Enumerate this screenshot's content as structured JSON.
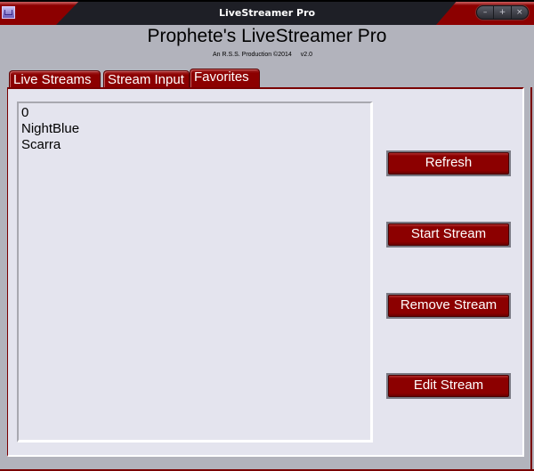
{
  "window": {
    "title": "LiveStreamer Pro",
    "controls": {
      "minimize": "–",
      "maximize": "+",
      "close": "×"
    }
  },
  "header": {
    "title": "Prophete's LiveStreamer Pro",
    "subtitle": "An R.S.S. Production ©2014",
    "version": "v2.0"
  },
  "tabs": [
    {
      "label": "Live Streams",
      "active": false
    },
    {
      "label": "Stream Input",
      "active": false
    },
    {
      "label": "Favorites",
      "active": true
    }
  ],
  "favorites": {
    "items": [
      "0",
      "NightBlue",
      "Scarra"
    ]
  },
  "buttons": {
    "refresh": "Refresh",
    "start_stream": "Start Stream",
    "remove_stream": "Remove Stream",
    "edit_stream": "Edit Stream"
  },
  "colors": {
    "accent": "#8c0000",
    "titlebar": "#1e1f26",
    "window_bg": "#b2b3bc",
    "panel_bg": "#e4e4ee"
  }
}
